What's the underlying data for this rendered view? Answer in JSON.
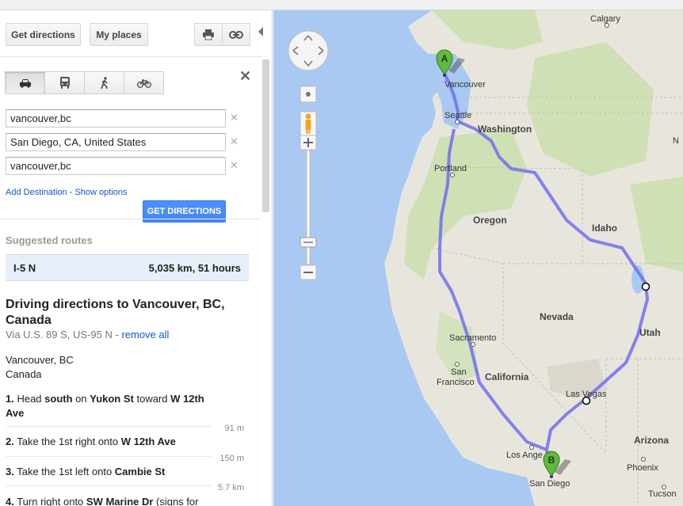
{
  "toolbar": {
    "get_directions_label": "Get directions",
    "my_places_label": "My places"
  },
  "modes": [
    {
      "name": "drive",
      "active": true
    },
    {
      "name": "transit",
      "active": false
    },
    {
      "name": "walk",
      "active": false
    },
    {
      "name": "bicycle",
      "active": false
    }
  ],
  "waypoints": [
    {
      "value": "vancouver,bc"
    },
    {
      "value": "San Diego, CA, United States"
    },
    {
      "value": "vancouver,bc"
    }
  ],
  "links": {
    "add_destination": "Add Destination",
    "separator": " - ",
    "show_options": "Show options",
    "remove_all": "remove all"
  },
  "get_directions_button": "GET DIRECTIONS",
  "suggested": {
    "title": "Suggested routes",
    "routes": [
      {
        "name": "I-5 N",
        "meta": "5,035 km, 51 hours"
      }
    ]
  },
  "directions": {
    "title": "Driving directions to Vancouver, BC, Canada",
    "via": "Via U.S. 89 S, US-95 N - ",
    "start_line1": "Vancouver, BC",
    "start_line2": "Canada",
    "steps": [
      {
        "num": "1.",
        "pre": " Head ",
        "b1": "south",
        "mid": " on ",
        "b2": "Yukon St",
        "mid2": " toward ",
        "b3": "W 12th Ave",
        "dist": "91 m"
      },
      {
        "num": "2.",
        "pre": " Take the 1st right onto ",
        "b1": "W 12th Ave",
        "dist": "150 m"
      },
      {
        "num": "3.",
        "pre": " Take the 1st left onto ",
        "b1": "Cambie St",
        "dist": "5.7 km"
      },
      {
        "num": "4.",
        "pre": " Turn right onto ",
        "b1": "SW Marine Dr",
        "post": " (signs for"
      }
    ]
  },
  "map": {
    "labels": {
      "calgary": "Calgary",
      "vancouver": "Vancouver",
      "seattle": "Seattle",
      "washington": "Washington",
      "portland": "Portland",
      "oregon": "Oregon",
      "idaho": "Idaho",
      "nevada": "Nevada",
      "utah": "Utah",
      "sacramento": "Sacramento",
      "san_francisco_1": "San",
      "san_francisco_2": "Francisco",
      "california": "California",
      "las_vegas": "Las Vegas",
      "los_angeles": "Los Ange",
      "san_diego": "San Diego",
      "arizona": "Arizona",
      "phoenix": "Phoenix",
      "tucson": "Tucson",
      "partial_n": "N"
    },
    "marker_a": "A",
    "marker_b": "B",
    "colors": {
      "water": "#a9c9f2",
      "land": "#e8e6dc",
      "forest": "#cfe0b5",
      "route": "#6f6ff0",
      "marker": "#5fba3e"
    }
  }
}
